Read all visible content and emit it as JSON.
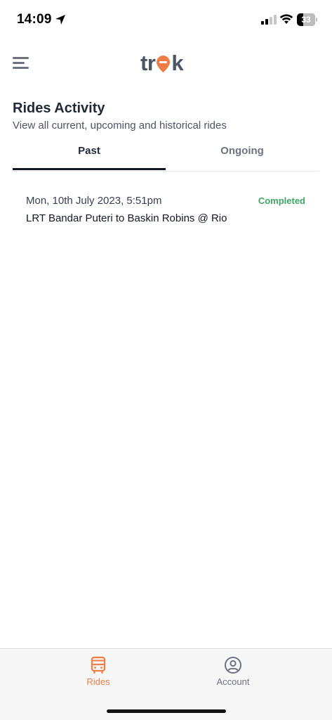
{
  "status_bar": {
    "time": "14:09",
    "battery": "33",
    "battery_level": 0.33
  },
  "header": {
    "logo_text_start": "tr",
    "logo_text_end": "k",
    "brand_color": "#f07d46"
  },
  "page": {
    "title": "Rides Activity",
    "subtitle": "View all current, upcoming and historical rides"
  },
  "tabs": [
    {
      "label": "Past",
      "active": true
    },
    {
      "label": "Ongoing",
      "active": false
    }
  ],
  "rides": [
    {
      "date": "Mon, 10th July 2023, 5:51pm",
      "status": "Completed",
      "status_color": "#3fa563",
      "route": "LRT Bandar Puteri to Baskin Robins @ Rio"
    }
  ],
  "bottom_nav": [
    {
      "label": "Rides",
      "icon": "bus-icon",
      "active": true
    },
    {
      "label": "Account",
      "icon": "user-circle-icon",
      "active": false
    }
  ]
}
